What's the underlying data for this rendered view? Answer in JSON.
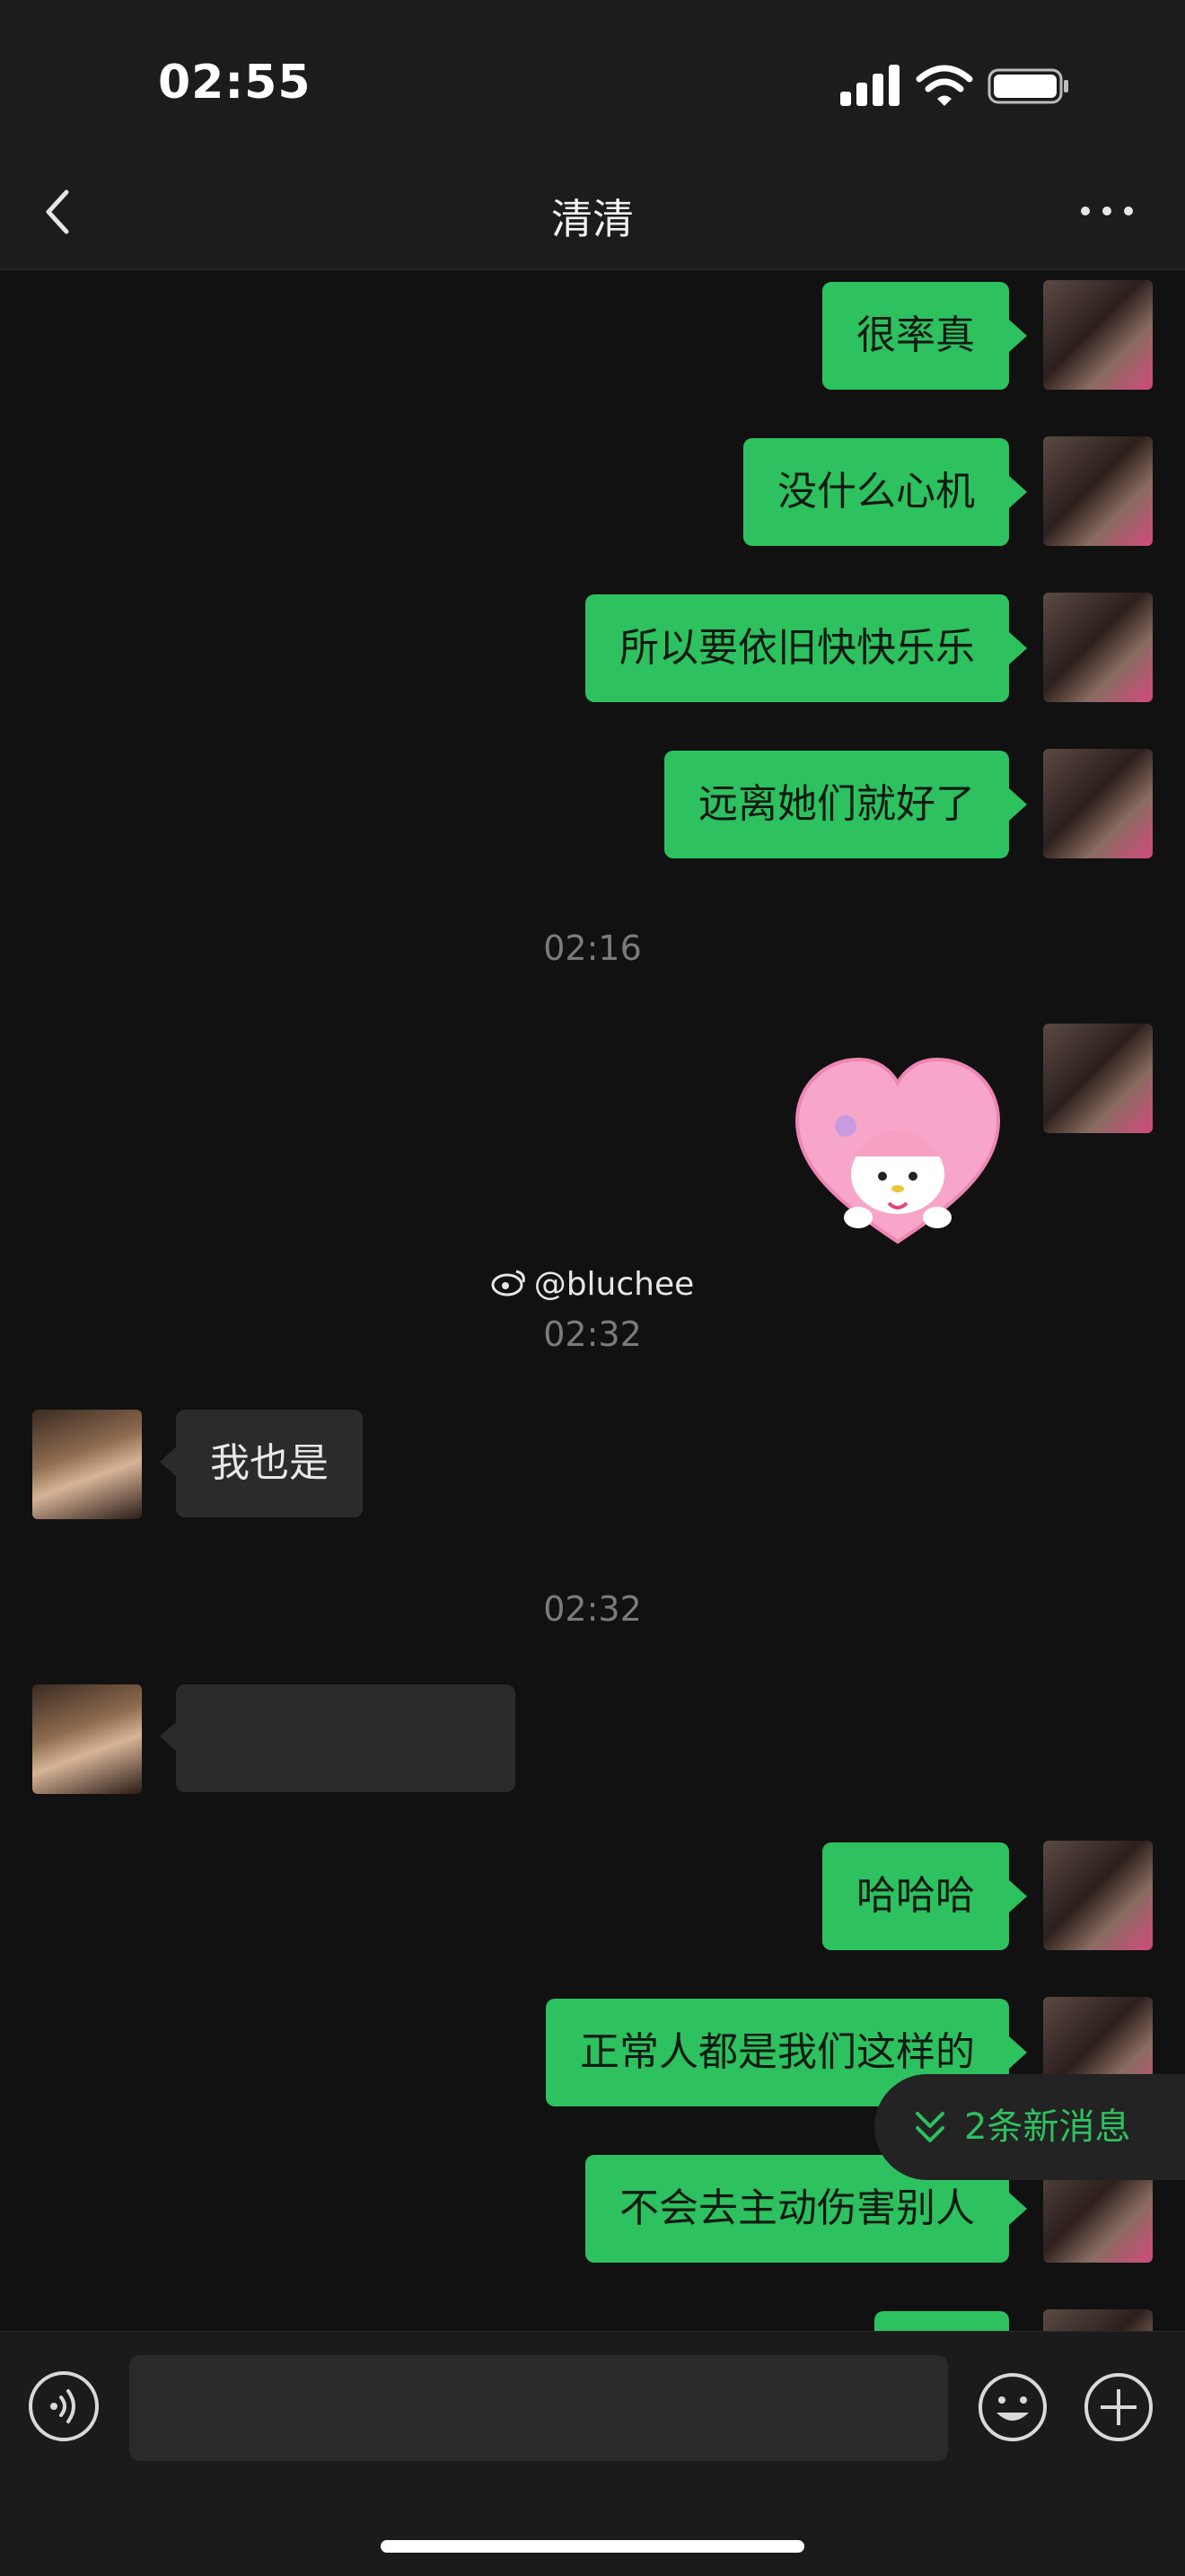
{
  "status": {
    "time": "02:55"
  },
  "nav": {
    "title": "清清",
    "back_icon": "chevron-left-icon",
    "more_icon": "more-dots-icon"
  },
  "messages": [
    {
      "side": "me",
      "text": "很率真"
    },
    {
      "side": "me",
      "text": "没什么心机"
    },
    {
      "side": "me",
      "text": "所以要依旧快快乐乐"
    },
    {
      "side": "me",
      "text": "远离她们就好了"
    },
    {
      "timestamp": "02:16"
    },
    {
      "side": "me",
      "sticker": "pink-heart-melody-sticker"
    },
    {
      "watermark": "@bluchee"
    },
    {
      "timestamp": "02:32"
    },
    {
      "side": "other",
      "text": "我也是"
    },
    {
      "timestamp": "02:32"
    },
    {
      "side": "other",
      "text": ""
    },
    {
      "side": "me",
      "text": "哈哈哈"
    },
    {
      "side": "me",
      "text": "正常人都是我们这样的"
    },
    {
      "side": "me",
      "text": "不会去主动伤害别人"
    }
  ],
  "new_messages": {
    "label": "2条新消息"
  },
  "input": {
    "value": "",
    "icons": [
      "voice-icon",
      "mic-icon",
      "emoji-icon",
      "plus-icon"
    ]
  },
  "colors": {
    "bubble_me": "#2ec15f",
    "bubble_other": "#2b2b2b",
    "background": "#111111"
  }
}
